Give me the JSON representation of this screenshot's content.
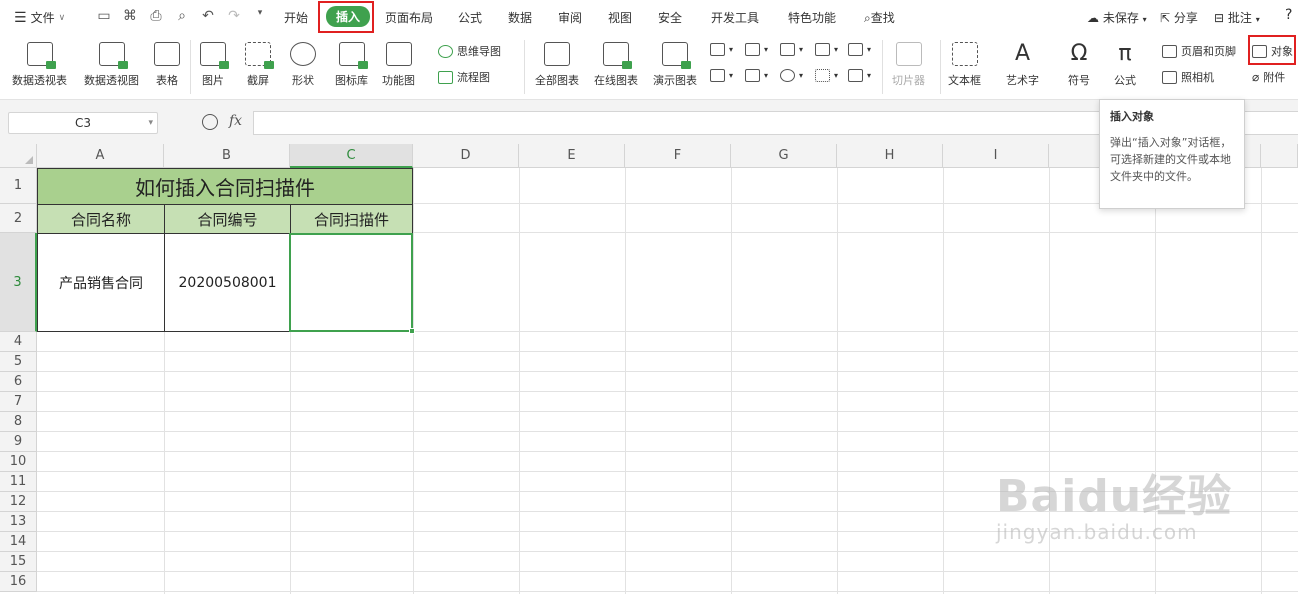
{
  "menu": {
    "file_label": "文件",
    "tabs": [
      "开始",
      "插入",
      "页面布局",
      "公式",
      "数据",
      "审阅",
      "视图",
      "安全",
      "开发工具",
      "特色功能"
    ],
    "active_tab": "插入",
    "search_label": "查找",
    "right": {
      "unsaved": "未保存",
      "share": "分享",
      "comment": "批注",
      "help": "?"
    }
  },
  "ribbon": {
    "pivot_table": "数据透视表",
    "pivot_chart": "数据透视图",
    "table": "表格",
    "picture": "图片",
    "screenshot": "截屏",
    "shape": "形状",
    "icon_lib": "图标库",
    "function_chart": "功能图",
    "mindmap": "思维导图",
    "flowchart": "流程图",
    "all_charts": "全部图表",
    "online_charts": "在线图表",
    "demo_charts": "演示图表",
    "slicer": "切片器",
    "textbox": "文本框",
    "wordart": "艺术字",
    "symbol": "符号",
    "formula": "公式",
    "header_footer": "页眉和页脚",
    "camera": "照相机",
    "object": "对象",
    "attachment": "附件"
  },
  "formula_bar": {
    "name_box": "C3",
    "fx": "fx",
    "value": ""
  },
  "tooltip": {
    "title": "插入对象",
    "body": "弹出“插入对象”对话框，可选择新建的文件或本地文件夹中的文件。"
  },
  "columns": [
    "A",
    "B",
    "C",
    "D",
    "E",
    "F",
    "G",
    "H",
    "I"
  ],
  "rows": [
    "1",
    "2",
    "3",
    "4",
    "5",
    "6",
    "7",
    "8",
    "9",
    "10",
    "11",
    "12",
    "13",
    "14",
    "15",
    "16"
  ],
  "sheet": {
    "title": "如何插入合同扫描件",
    "headers": [
      "合同名称",
      "合同编号",
      "合同扫描件"
    ],
    "row3": [
      "产品销售合同",
      "20200508001",
      ""
    ],
    "selected_cell": "C3"
  },
  "watermark": {
    "brand": "Baidu经验",
    "url": "jingyan.baidu.com"
  },
  "colors": {
    "accent": "#3fa14e",
    "title_fill": "#a9d08e",
    "header_fill": "#c6e0b4",
    "highlight": "#e02020"
  }
}
